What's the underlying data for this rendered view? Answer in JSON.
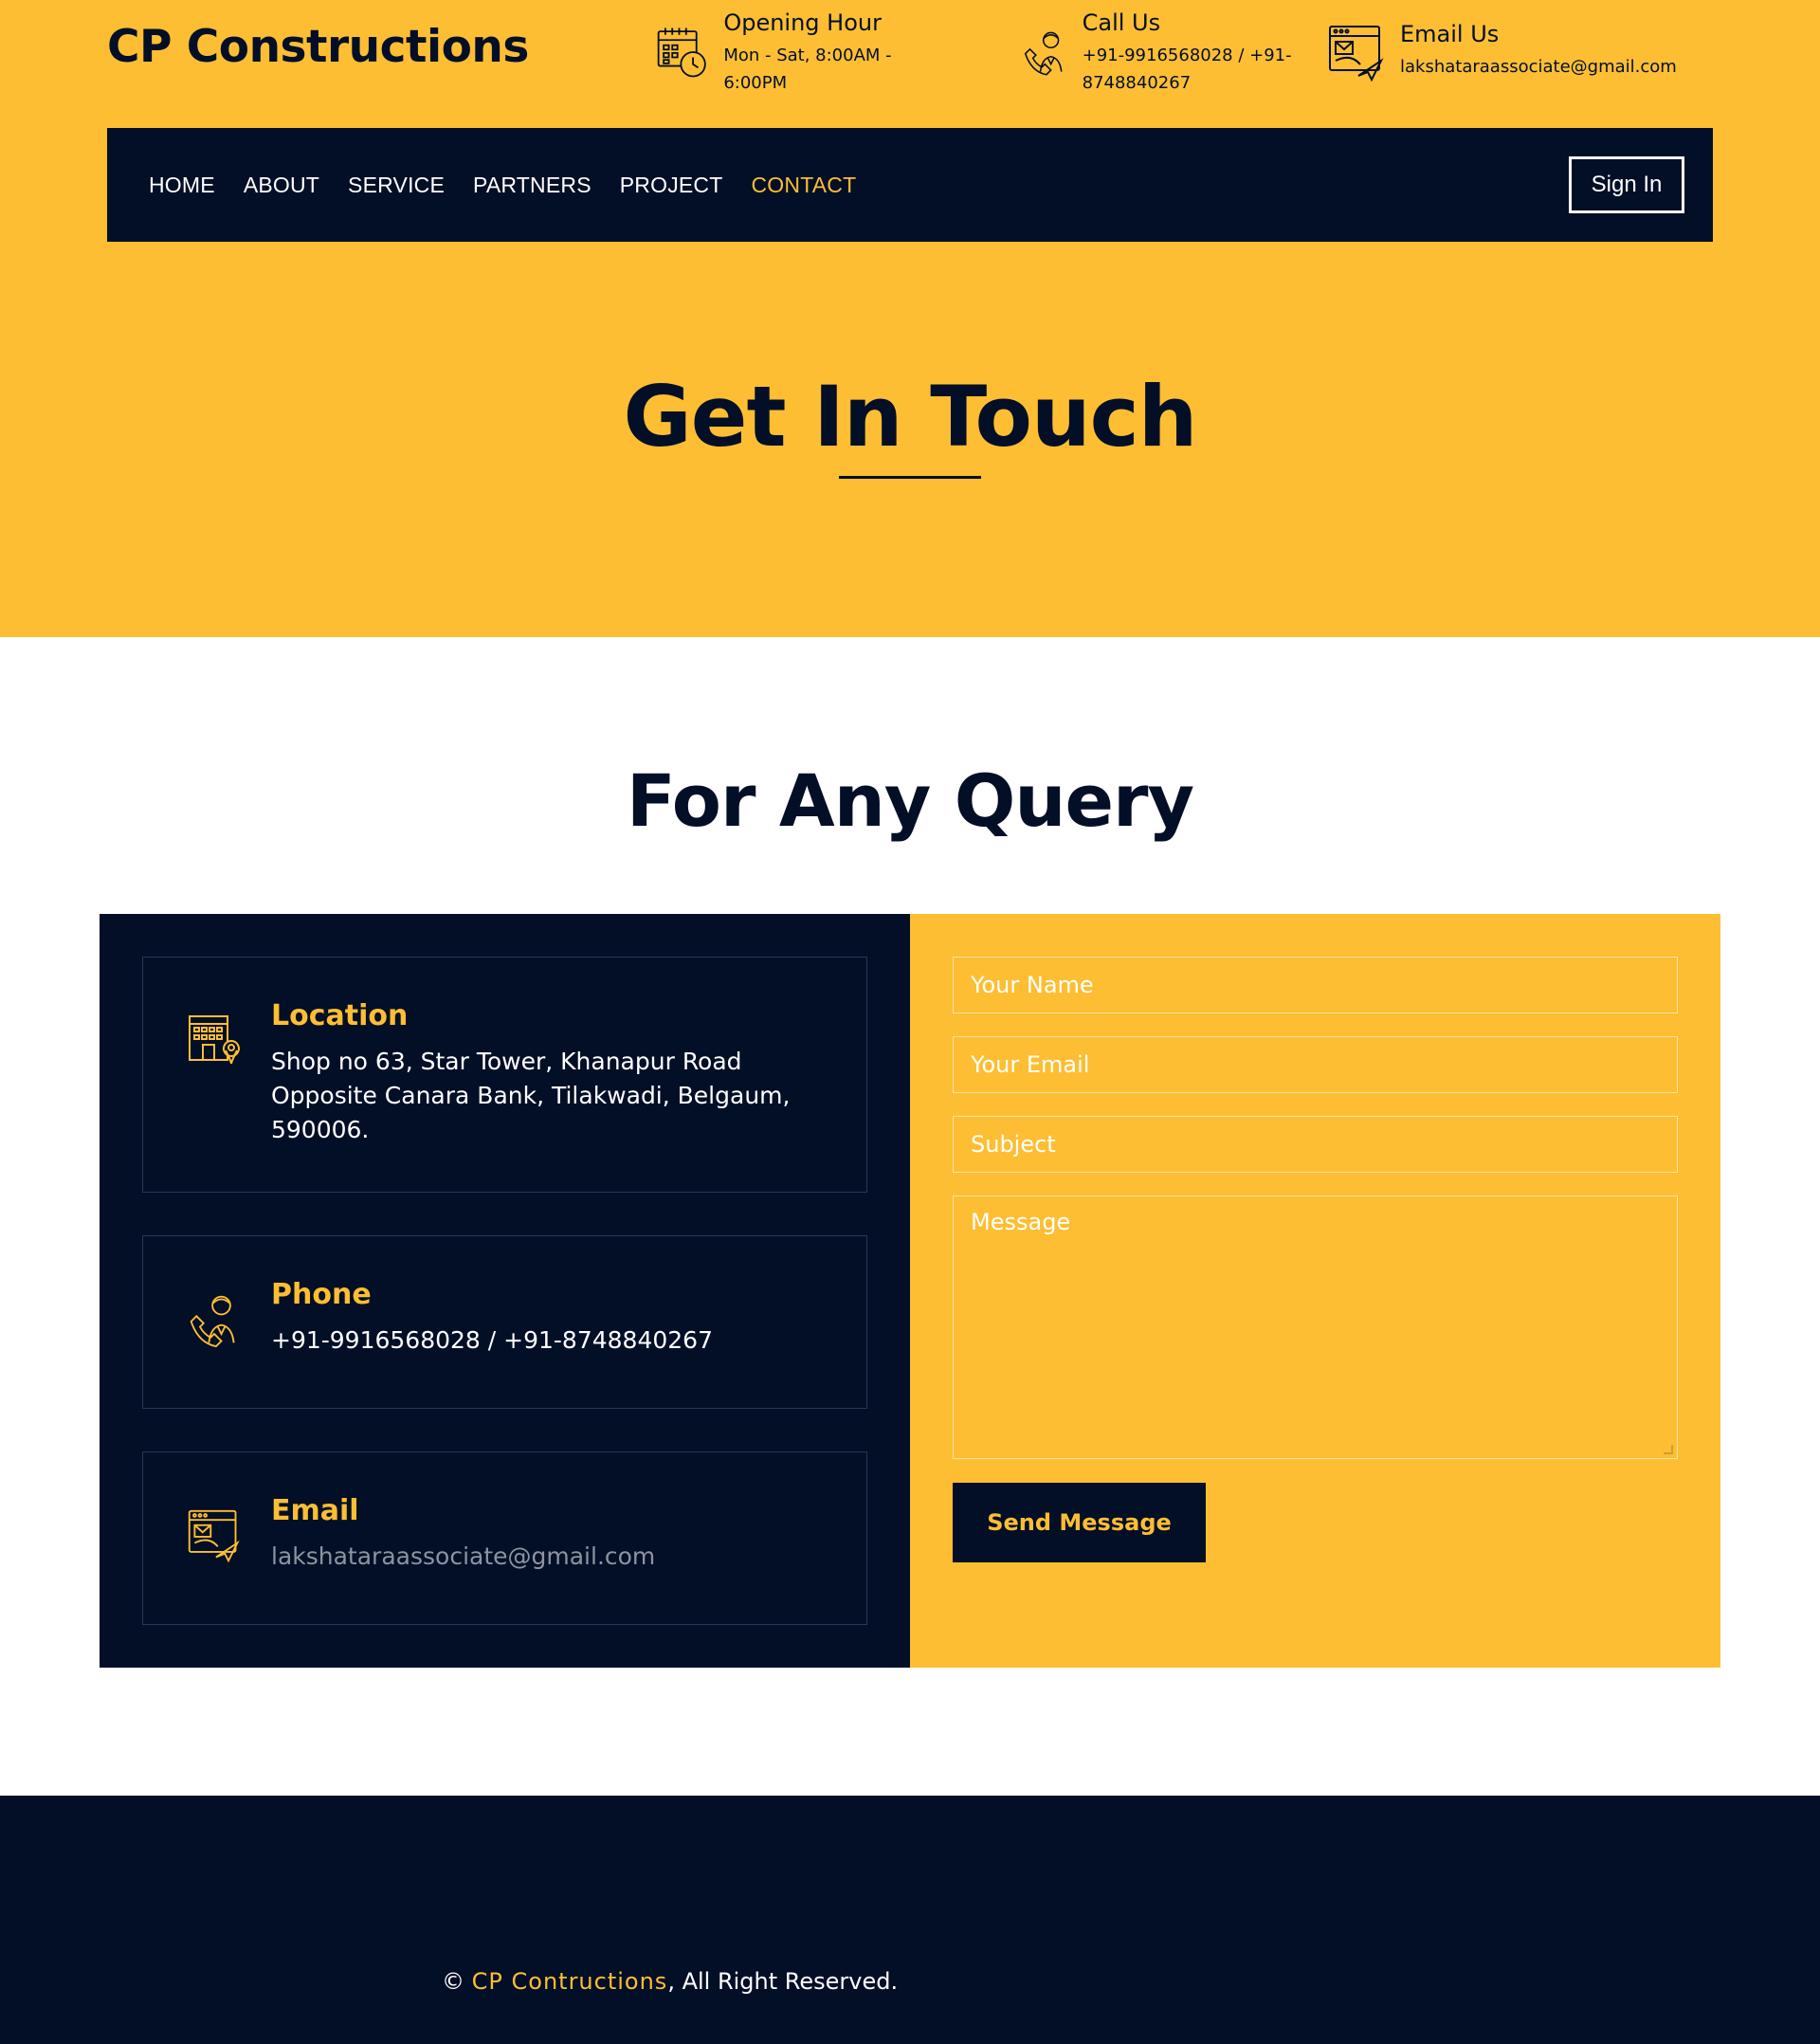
{
  "colors": {
    "accent": "#fdbe33",
    "dark": "#030f27",
    "white": "#ffffff"
  },
  "header": {
    "brand": "CP Constructions",
    "opening": {
      "title": "Opening Hour",
      "value": "Mon - Sat, 8:00AM - 6:00PM",
      "icon": "calendar-clock-icon"
    },
    "call": {
      "title": "Call Us",
      "value": "+91-9916568028 / +91-8748840267",
      "icon": "support-agent-icon"
    },
    "email": {
      "title": "Email Us",
      "value": "lakshataraassociate@gmail.com",
      "icon": "mail-window-icon"
    }
  },
  "nav": {
    "items": [
      {
        "label": "HOME"
      },
      {
        "label": "ABOUT"
      },
      {
        "label": "SERVICE"
      },
      {
        "label": "PARTNERS"
      },
      {
        "label": "PROJECT"
      },
      {
        "label": "CONTACT",
        "active": true
      }
    ],
    "signin_label": "Sign In"
  },
  "hero": {
    "title": "Get In Touch"
  },
  "query": {
    "title": "For Any Query",
    "cards": [
      {
        "title": "Location",
        "value": "Shop no 63, Star Tower, Khanapur Road Opposite Canara Bank, Tilakwadi, Belgaum, 590006.",
        "icon": "building-location-icon"
      },
      {
        "title": "Phone",
        "value": "+91-9916568028 / +91-8748840267",
        "icon": "support-agent-icon"
      },
      {
        "title": "Email",
        "value": "lakshataraassociate@gmail.com",
        "icon": "mail-window-icon"
      }
    ],
    "form": {
      "name_placeholder": "Your Name",
      "email_placeholder": "Your Email",
      "subject_placeholder": "Subject",
      "message_placeholder": "Message",
      "send_label": "Send Message"
    }
  },
  "footer": {
    "copyright_symbol": "©",
    "brand": "CP Contructions",
    "rights": ", All Right Reserved."
  }
}
